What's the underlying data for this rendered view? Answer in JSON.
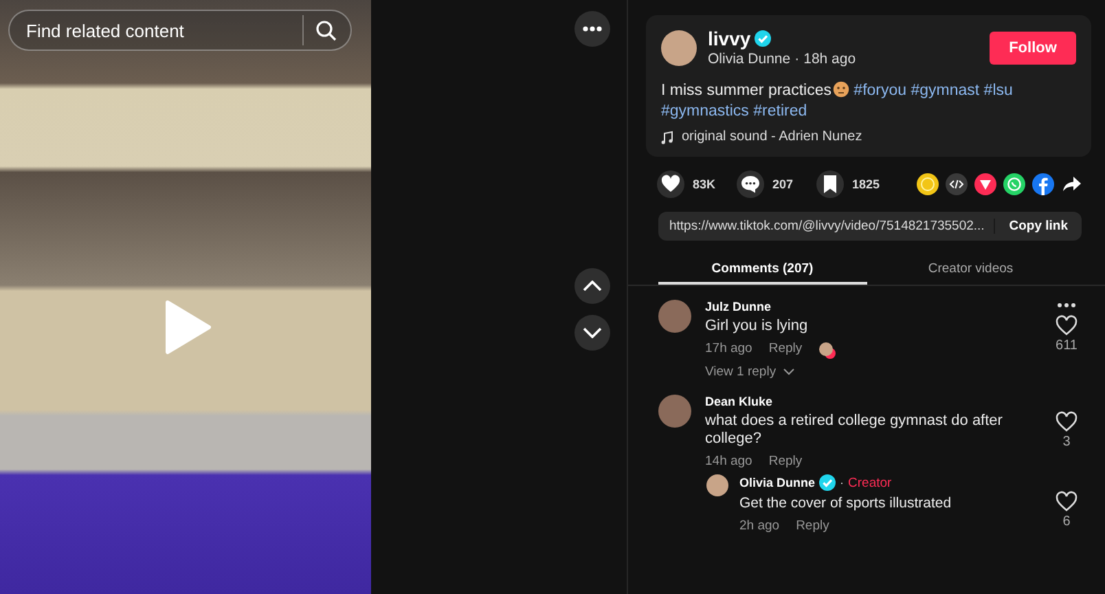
{
  "video": {
    "search": {
      "placeholder": "Find related content"
    },
    "playing": false
  },
  "post": {
    "username": "livvy",
    "verified": true,
    "display_name": "Olivia Dunne",
    "separator": "·",
    "time": "18h ago",
    "follow_button": "Follow",
    "caption": "I miss summer practices",
    "hashtags": [
      "#foryou",
      "#gymnast",
      "#lsu",
      "#gymnastics",
      "#retired"
    ],
    "sound": "original sound - Adrien Nunez"
  },
  "stats": [
    {
      "kind": "like",
      "count": "83K"
    },
    {
      "kind": "comment",
      "count": "207"
    },
    {
      "kind": "save",
      "count": "1825"
    }
  ],
  "share": [
    {
      "kind": "coin"
    },
    {
      "kind": "embed"
    },
    {
      "kind": "send"
    },
    {
      "kind": "whatsapp"
    },
    {
      "kind": "facebook"
    },
    {
      "kind": "forward"
    }
  ],
  "link": {
    "url": "https://www.tiktok.com/@livvy/video/7514821735502...",
    "button": "Copy link"
  },
  "tabs": [
    {
      "label": "Comments (207)",
      "selected": true
    },
    {
      "label": "Creator videos",
      "selected": false
    }
  ],
  "comments": [
    {
      "author": "Julz Dunne",
      "text": "Girl you is lying",
      "time": "17h ago",
      "reply": "Reply",
      "likes": "611",
      "liked_by_creator": true,
      "view_replies": "View 1 reply"
    },
    {
      "author": "Dean Kluke",
      "text": "what does a retired college gymnast do after college?",
      "time": "14h ago",
      "reply": "Reply",
      "likes": "3",
      "liked_by_creator": false,
      "children": [
        {
          "author": "Olivia Dunne",
          "verified": true,
          "separator": "·",
          "badge": "Creator",
          "text": "Get the cover of sports illustrated",
          "time": "2h ago",
          "reply": "Reply",
          "likes": "6",
          "liked_by_creator": false
        }
      ]
    }
  ]
}
